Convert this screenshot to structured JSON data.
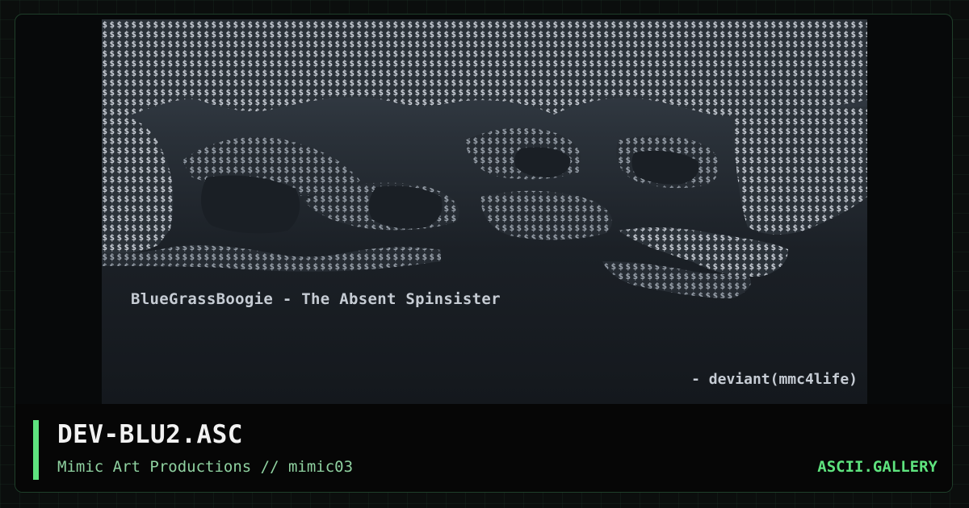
{
  "artwork": {
    "caption": "BlueGrassBoogie - The Absent Spinsister",
    "credit": "- deviant(mmc4life)"
  },
  "footer": {
    "title": "DEV-BLU2.ASC",
    "subtitle": "Mimic Art Productions // mimic03",
    "brand": "ASCII.GALLERY"
  },
  "colors": {
    "accent": "#5ee37e",
    "subtitle": "#8fd1a0",
    "background": "#0b0e0d",
    "footer_background": "#060606"
  }
}
